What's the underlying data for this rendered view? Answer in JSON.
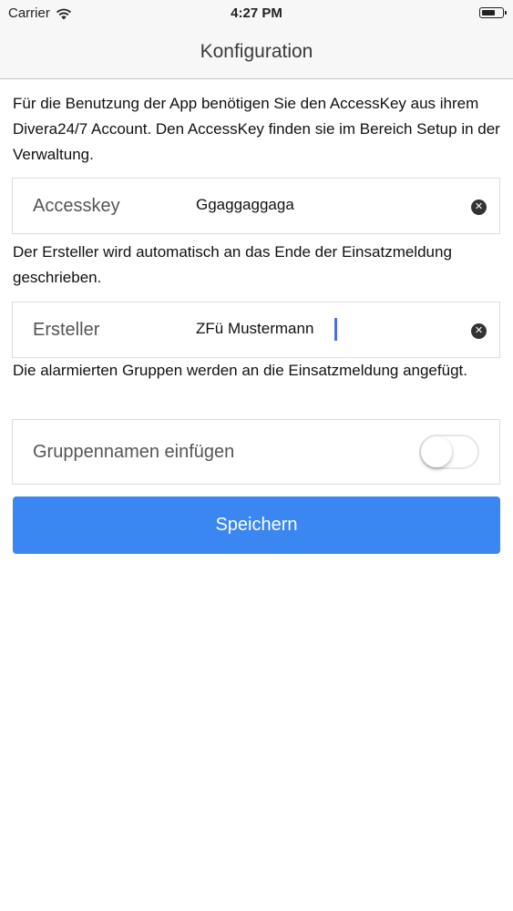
{
  "status_bar": {
    "carrier": "Carrier",
    "time": "4:27 PM"
  },
  "nav": {
    "title": "Konfiguration"
  },
  "accesskey_section": {
    "description": "Für die Benutzung der App benötigen Sie den AccessKey aus ihrem Divera24/7 Account. Den AccessKey finden sie im Bereich Setup in der Verwaltung.",
    "label": "Accesskey",
    "value": "Ggaggaggaga"
  },
  "ersteller_section": {
    "description": "Der Ersteller wird automatisch an das Ende der Einsatzmeldung geschrieben.",
    "label": "Ersteller",
    "value": "ZFü Mustermann"
  },
  "gruppen_section": {
    "description": "Die alarmierten Gruppen werden an die Einsatzmeldung angefügt.",
    "label": "Gruppennamen einfügen",
    "toggle_on": false
  },
  "save_button": {
    "label": "Speichern",
    "color": "#3a87f2"
  }
}
